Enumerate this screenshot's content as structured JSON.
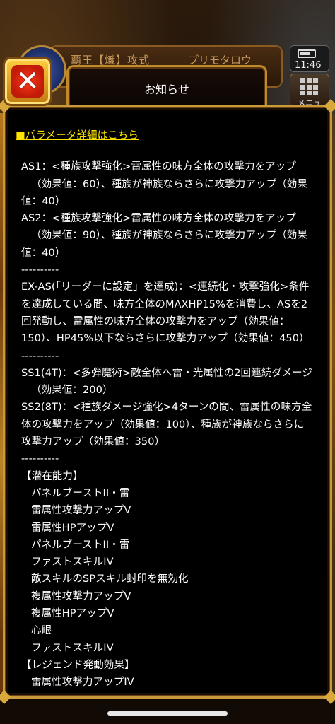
{
  "hud": {
    "title": "覇王【熾】攻式",
    "player_name": "プリモタロウ",
    "time": "11:46",
    "menu_label": "メニュ"
  },
  "dialog": {
    "title": "お知らせ",
    "close_label": "✕",
    "link": "■パラメータ詳細はこちら",
    "lines": [
      "AS1：<種族攻撃強化>雷属性の味方全体の攻撃力をアップ",
      "（効果値：60）、種族が神族ならさらに攻撃力アップ（効果",
      "値：40）",
      "AS2：<種族攻撃強化>雷属性の味方全体の攻撃力をアップ",
      "（効果値：90）、種族が神族ならさらに攻撃力アップ（効果",
      "値：40）",
      "----------",
      "EX-AS(「リーダーに設定」を達成)：<連続化・攻撃強化>条件",
      "を達成している間、味方全体のMAXHP15%を消費し、ASを2",
      "回発動し、雷属性の味方全体の攻撃力をアップ（効果値：",
      "150）、HP45%以下ならさらに攻撃力アップ（効果値：450）",
      "----------",
      "SS1(4T)：<多弾魔術>敵全体へ雷・光属性の2回連続ダメージ",
      "（効果値：200）",
      "SS2(8T)：<種族ダメージ強化>4ターンの間、雷属性の味方全",
      "体の攻撃力をアップ（効果値：100）、種族が神族ならさらに",
      "攻撃力アップ（効果値：350）",
      "----------"
    ],
    "latent_header": "【潜在能力】",
    "latent": [
      "パネルブーストII・雷",
      "雷属性攻撃力アップV",
      "雷属性HPアップV",
      "パネルブーストII・雷",
      "ファストスキルIV",
      "敵スキルのSPスキル封印を無効化",
      "複属性攻撃力アップV",
      "複属性HPアップV",
      "心眼",
      "ファストスキルIV"
    ],
    "legend_header": "【レジェンド発動効果】",
    "legend": [
      "雷属性攻撃力アップIV"
    ]
  },
  "colors": {
    "frame_gold": "#c99a3a",
    "link_yellow": "#ffe400",
    "close_red": "#e0240e"
  }
}
